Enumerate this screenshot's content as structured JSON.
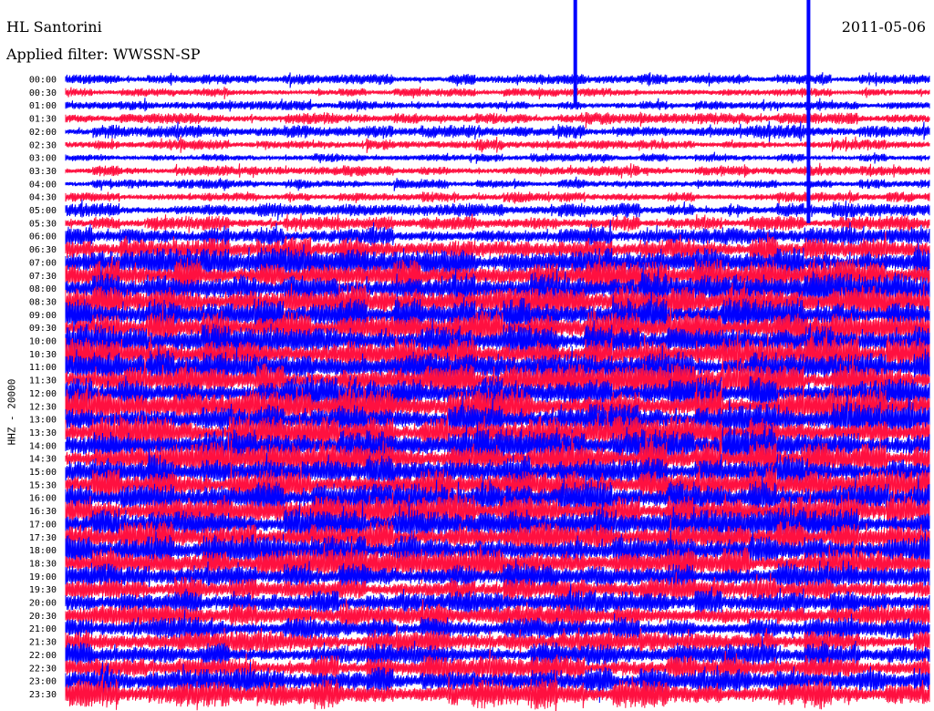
{
  "header": {
    "station": "HL Santorini",
    "date": "2011-05-06",
    "filter_text": "Applied filter: WWSSN-SP",
    "channel": "HHZ - 20000"
  },
  "colors": {
    "trace_a": "#0000ff",
    "trace_b": "#ff1040",
    "background": "#ffffff"
  },
  "chart_data": {
    "type": "line",
    "title": "HL Santorini",
    "subtitle": "Applied filter: WWSSN-SP",
    "xlabel": "",
    "ylabel": "HHZ - 20000",
    "date": "2011-05-06",
    "rows": [
      "00:00",
      "00:30",
      "01:00",
      "01:30",
      "02:00",
      "02:30",
      "03:00",
      "03:30",
      "04:00",
      "04:30",
      "05:00",
      "05:30",
      "06:00",
      "06:30",
      "07:00",
      "07:30",
      "08:00",
      "08:30",
      "09:00",
      "09:30",
      "10:00",
      "10:30",
      "11:00",
      "11:30",
      "12:00",
      "12:30",
      "13:00",
      "13:30",
      "14:00",
      "14:30",
      "15:00",
      "15:30",
      "16:00",
      "16:30",
      "17:00",
      "17:30",
      "18:00",
      "18:30",
      "19:00",
      "19:30",
      "20:00",
      "20:30",
      "21:00",
      "21:30",
      "22:00",
      "22:30",
      "23:00",
      "23:30"
    ],
    "series": [
      {
        "color": "#0000ff",
        "rows": "even"
      },
      {
        "color": "#ff1040",
        "rows": "odd"
      }
    ],
    "relative_amplitude": [
      0.45,
      0.35,
      0.4,
      0.5,
      0.55,
      0.45,
      0.35,
      0.45,
      0.4,
      0.45,
      0.55,
      0.6,
      0.8,
      1.0,
      1.2,
      1.3,
      1.3,
      1.35,
      1.3,
      1.35,
      1.35,
      1.4,
      1.35,
      1.35,
      1.4,
      1.4,
      1.35,
      1.35,
      1.4,
      1.35,
      1.35,
      1.35,
      1.3,
      1.3,
      1.3,
      1.3,
      1.25,
      1.25,
      1.1,
      1.0,
      0.95,
      0.95,
      0.95,
      0.9,
      1.0,
      1.0,
      1.1,
      1.2
    ],
    "spikes": [
      {
        "row": 0,
        "position": 0.59,
        "extent_rows": 2
      },
      {
        "row": 0,
        "position": 0.86,
        "extent_rows": 11
      }
    ],
    "grid": false,
    "legend": "none"
  }
}
